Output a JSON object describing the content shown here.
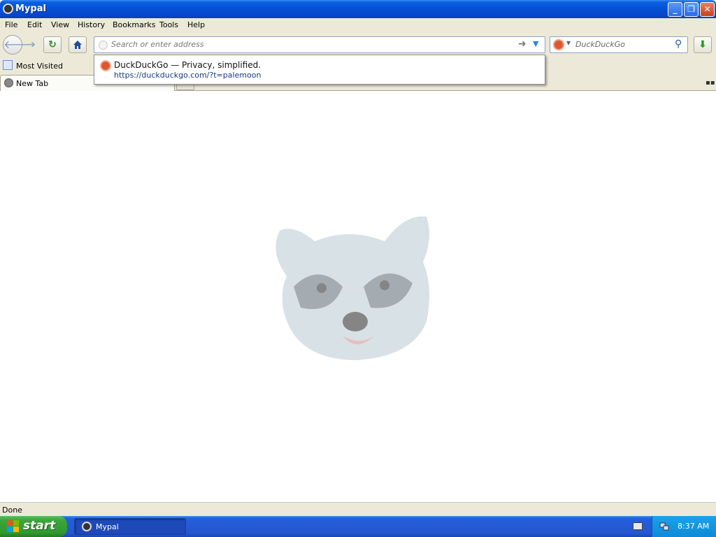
{
  "window": {
    "title": "Mypal",
    "icon": "raccoon-icon"
  },
  "menu": {
    "file": "File",
    "edit": "Edit",
    "view": "View",
    "history": "History",
    "bookmarks": "Bookmarks",
    "tools": "Tools",
    "help": "Help"
  },
  "navbar": {
    "url_placeholder": "Search or enter address",
    "url_value": "",
    "search_engine": "DuckDuckGo",
    "search_placeholder": "DuckDuckGo"
  },
  "bookmarks_toolbar": {
    "items": [
      {
        "label": "Most Visited"
      }
    ]
  },
  "tabs": [
    {
      "label": "New Tab",
      "active": true
    }
  ],
  "autocomplete": {
    "items": [
      {
        "title": "DuckDuckGo — Privacy, simplified.",
        "url": "https://duckduckgo.com/?t=palemoon"
      }
    ]
  },
  "content": {
    "logo": "mypal-raccoon-logo"
  },
  "statusbar": {
    "text": "Done"
  },
  "taskbar": {
    "start_label": "start",
    "tasks": [
      {
        "label": "Mypal"
      }
    ],
    "clock": "8:37 AM"
  },
  "colors": {
    "titlebar": "#0551d6",
    "chrome": "#ece9d8",
    "taskbar": "#245edb",
    "start": "#3ca53c",
    "tray": "#0f8ad8",
    "ddg_orange": "#de5833"
  }
}
